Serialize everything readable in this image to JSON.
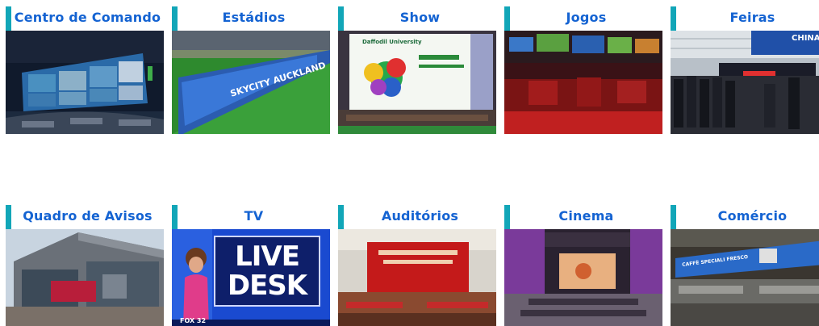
{
  "colors": {
    "title": "#1463d2",
    "accent_bar": "#12a6b8",
    "background": "#ffffff"
  },
  "tiles": [
    {
      "title": "Centro de Comando"
    },
    {
      "title": "Estádios",
      "sign_text": "SKYCITY AUCKLAND"
    },
    {
      "title": "Show",
      "sign_text": "Daffodil University"
    },
    {
      "title": "Jogos"
    },
    {
      "title": "Feiras",
      "sign_text": "CHINA"
    },
    {
      "title": "Quadro de Avisos"
    },
    {
      "title": "TV",
      "screen_line1": "LIVE",
      "screen_line2": "DESK",
      "channel": "FOX 32"
    },
    {
      "title": "Auditórios"
    },
    {
      "title": "Cinema"
    },
    {
      "title": "Comércio",
      "sign_text": "CAFFÈ SPECIALI FRESCO"
    }
  ]
}
